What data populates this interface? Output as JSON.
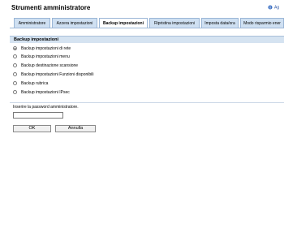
{
  "header": {
    "title": "Strumenti amministratore",
    "top_link": "Ag"
  },
  "tabs": [
    {
      "label": "Amministratore"
    },
    {
      "label": "Azzera impostazioni"
    },
    {
      "label": "Backup impostazioni",
      "active": true
    },
    {
      "label": "Ripristina impostazioni"
    },
    {
      "label": "Imposta data/ora"
    },
    {
      "label": "Modo risparmio ener"
    }
  ],
  "section": {
    "title": "Backup impostazioni",
    "options": [
      {
        "label": "Backup impostazioni di rete",
        "selected": true
      },
      {
        "label": "Backup impostazioni menu",
        "selected": false
      },
      {
        "label": "Backup destinazione scansione",
        "selected": false
      },
      {
        "label": "Backup impostazioni Funzioni disponibili",
        "selected": false
      },
      {
        "label": "Backup rubrica",
        "selected": false
      },
      {
        "label": "Backup impostazioni IPsec",
        "selected": false
      }
    ]
  },
  "password": {
    "label": "Inserire la password amministratore.",
    "value": ""
  },
  "buttons": {
    "ok": "OK",
    "cancel": "Annulla"
  },
  "colors": {
    "tab_bg": "#cfe0f2",
    "section_bg": "#d5e3f1",
    "link": "#2b55a6"
  }
}
